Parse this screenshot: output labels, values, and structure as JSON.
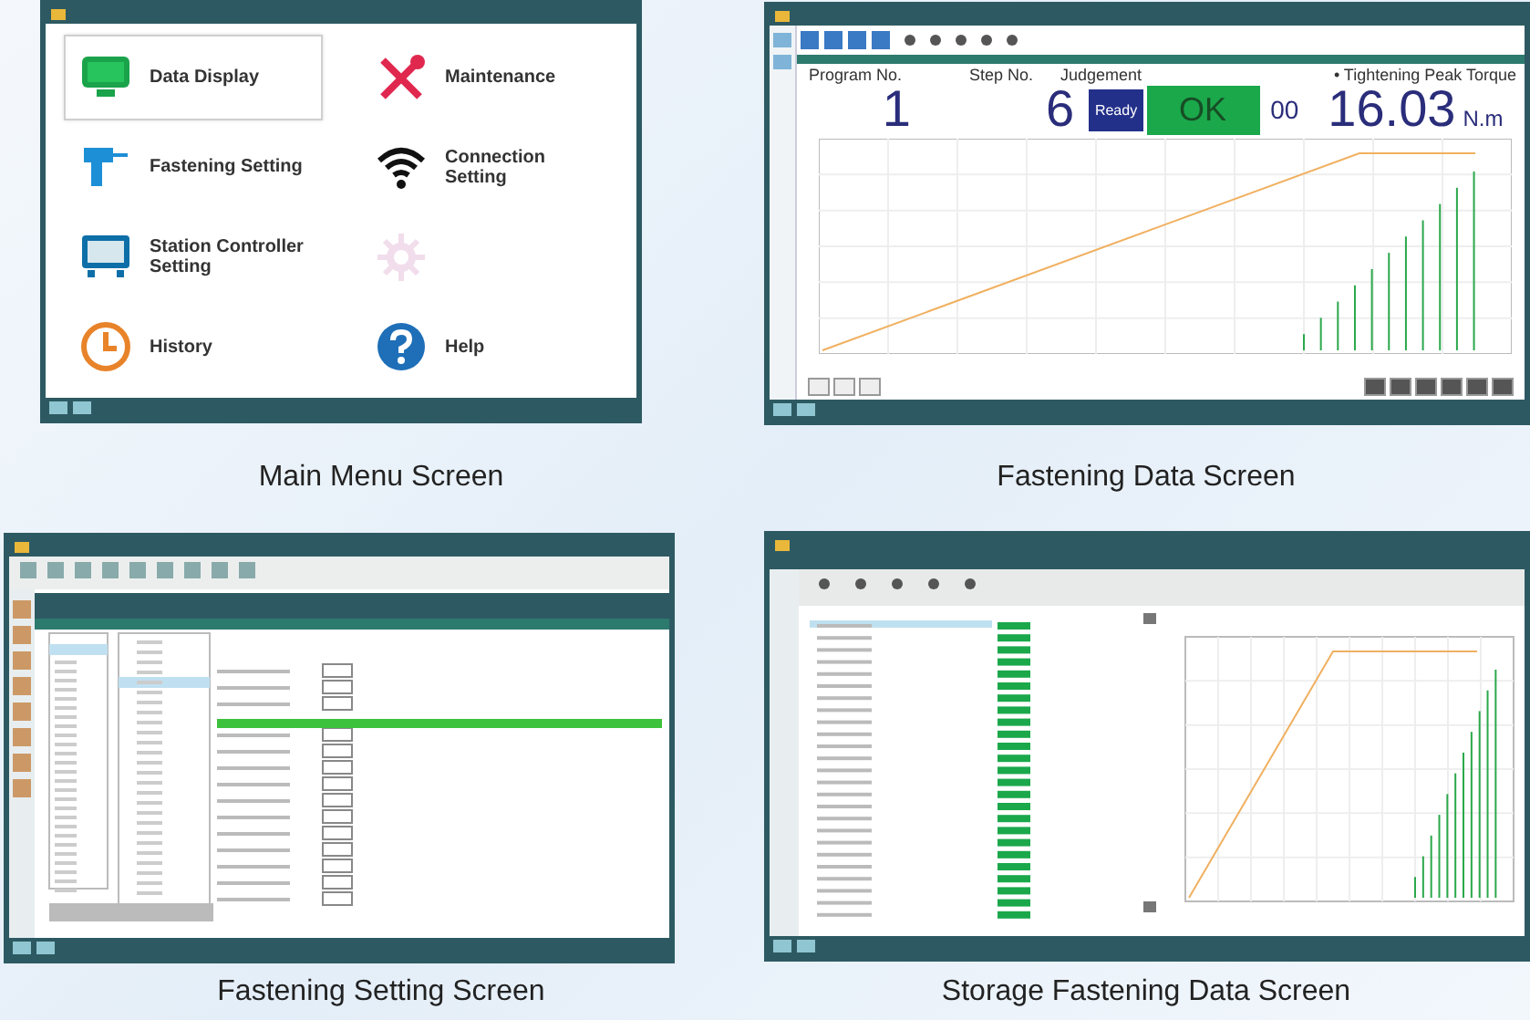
{
  "screens": [
    {
      "kind": "main_menu",
      "caption": "Main Menu Screen",
      "menu": [
        {
          "label": "Data Display",
          "selected": true,
          "disabled": false
        },
        {
          "label": "Maintenance",
          "selected": false,
          "disabled": false
        },
        {
          "label": "Fastening Setting",
          "selected": false,
          "disabled": false
        },
        {
          "label": "Connection Setting",
          "selected": false,
          "disabled": false
        },
        {
          "label": "Station Controller Setting",
          "selected": false,
          "disabled": false
        },
        {
          "selected": false,
          "disabled": true
        },
        {
          "label": "History",
          "selected": false,
          "disabled": false
        },
        {
          "label": "Help",
          "selected": false,
          "disabled": false
        }
      ]
    },
    {
      "kind": "fastening_data",
      "caption": "Fastening Data Screen",
      "program_label": "Program No.",
      "program": "1",
      "step_label": "Step No.",
      "step": "6",
      "judgement_label": "Judgement",
      "status": "Ready",
      "result": "OK",
      "code": "00",
      "torque_label": "• Tightening Peak Torque",
      "torque": "16.03",
      "unit": "N.m"
    },
    {
      "kind": "fastening_setting",
      "caption": "Fastening Setting Screen"
    },
    {
      "kind": "storage_data",
      "caption": "Storage Fastening Data Screen"
    }
  ]
}
